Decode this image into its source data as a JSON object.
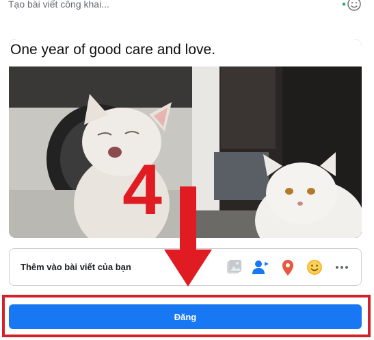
{
  "composer": {
    "placeholder": "Tạo bài viết công khai..."
  },
  "media": {
    "caption": "One year of good care and love."
  },
  "add_to_post": {
    "label": "Thêm vào bài viết của bạn",
    "icons": [
      "photo-video-icon",
      "tag-people-icon",
      "check-in-icon",
      "feeling-activity-icon",
      "more-icon"
    ]
  },
  "actions": {
    "post_label": "Đăng"
  },
  "annotation": {
    "step_number": "4"
  },
  "colors": {
    "accent": "#1877f2",
    "annotation_red": "#e11b22",
    "frame_red": "#d42029"
  }
}
